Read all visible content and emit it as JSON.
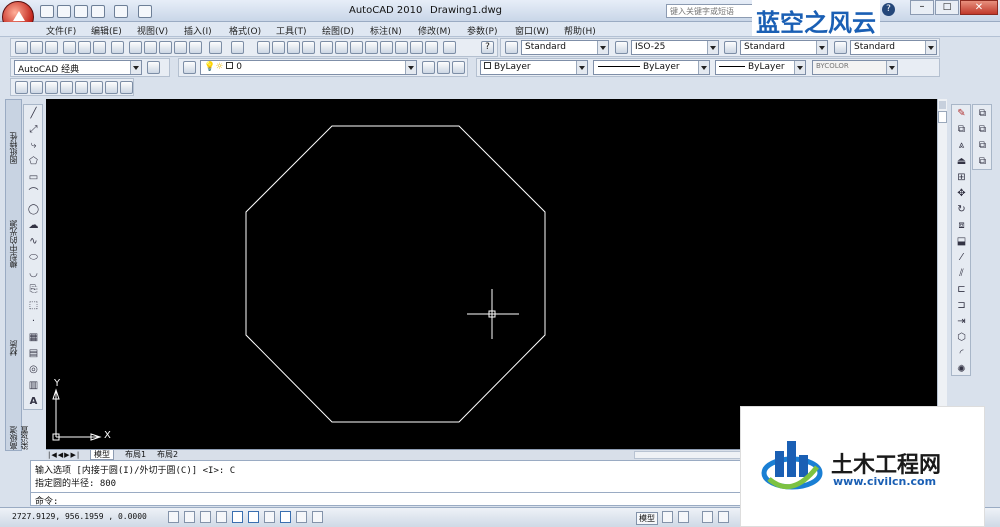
{
  "window": {
    "title": "AutoCAD 2010",
    "filename": "Drawing1.dwg",
    "help_search_placeholder": "键入关键字或短语"
  },
  "menu": [
    "文件(F)",
    "编辑(E)",
    "视图(V)",
    "插入(I)",
    "格式(O)",
    "工具(T)",
    "绘图(D)",
    "标注(N)",
    "修改(M)",
    "参数(P)",
    "窗口(W)",
    "帮助(H)"
  ],
  "styles": {
    "text_style": "Standard",
    "dim_style": "ISO-25",
    "table_style": "Standard",
    "mleader_style": "Standard"
  },
  "workspace": "AutoCAD 经典",
  "layer": "0",
  "properties": {
    "color": "ByLayer",
    "linetype": "ByLayer",
    "lineweight": "ByLayer",
    "plotstyle": "BYCOLOR"
  },
  "palette_labels": [
    "图纸特性",
    "模型中的光源",
    "材质",
    "高级渲染设置"
  ],
  "axis": {
    "x": "X",
    "y": "Y"
  },
  "tabs": [
    "模型",
    "布局1",
    "布局2"
  ],
  "command_lines": [
    "输入选项 [内接于圆(I)/外切于圆(C)] <I>: C",
    "指定圆的半径: 800"
  ],
  "command_prompt": "命令:",
  "status": {
    "coords": "2727.9129, 956.1959 , 0.0000",
    "model": "模型"
  },
  "watermark_top": "蓝空之风云",
  "watermark_brand": "土木工程网",
  "watermark_url": "www.civilcn.com",
  "colors": {
    "canvas": "#000000",
    "octagon": "#ffffff",
    "accent": "#1a5fb4"
  }
}
